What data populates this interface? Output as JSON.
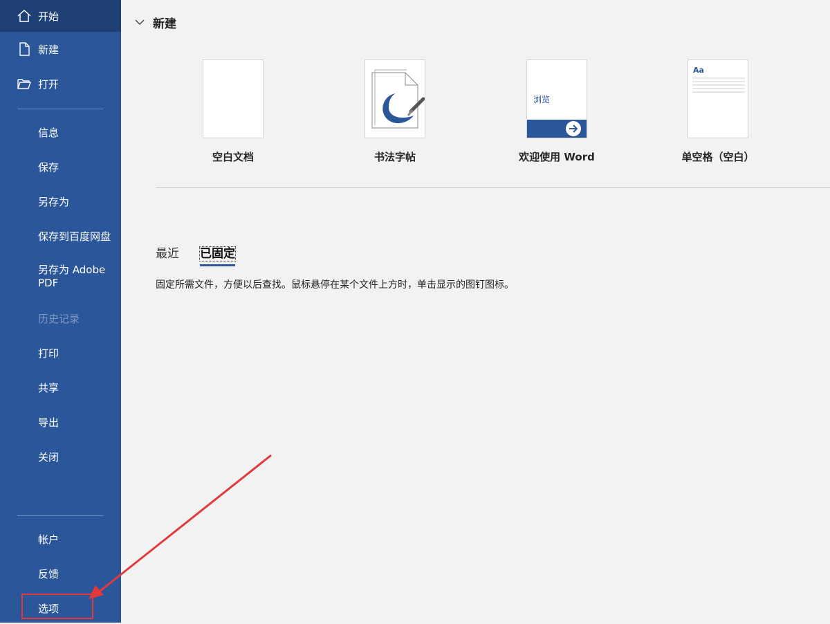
{
  "sidebar": {
    "home": {
      "label": "开始",
      "icon": "home-icon"
    },
    "new": {
      "label": "新建",
      "icon": "new-document-icon"
    },
    "open": {
      "label": "打开",
      "icon": "open-folder-icon"
    },
    "info": {
      "label": "信息"
    },
    "save": {
      "label": "保存"
    },
    "save_as": {
      "label": "另存为"
    },
    "save_baidu": {
      "label": "保存到百度网盘"
    },
    "save_adobe_line1": "另存为 Adobe",
    "save_adobe_line2": "PDF",
    "history": {
      "label": "历史记录"
    },
    "print": {
      "label": "打印"
    },
    "share": {
      "label": "共享"
    },
    "export": {
      "label": "导出"
    },
    "close": {
      "label": "关闭"
    },
    "account": {
      "label": "帐户"
    },
    "feedback": {
      "label": "反馈"
    },
    "options": {
      "label": "选项"
    }
  },
  "main": {
    "new_section_title": "新建",
    "templates": [
      {
        "label": "空白文档"
      },
      {
        "label": "书法字帖"
      },
      {
        "label": "欢迎使用 Word",
        "thumb_text": "浏览"
      },
      {
        "label": "单空格（空白）",
        "thumb_text": "Aa"
      }
    ],
    "tabs": [
      {
        "label": "最近"
      },
      {
        "label": "已固定"
      }
    ],
    "pinned_hint": "固定所需文件，方便以后查找。鼠标悬停在某个文件上方时，单击显示的图钉图标。"
  },
  "colors": {
    "sidebar_bg": "#2b579a",
    "sidebar_active": "#1e4074",
    "annotation_red": "#e23a3a"
  }
}
